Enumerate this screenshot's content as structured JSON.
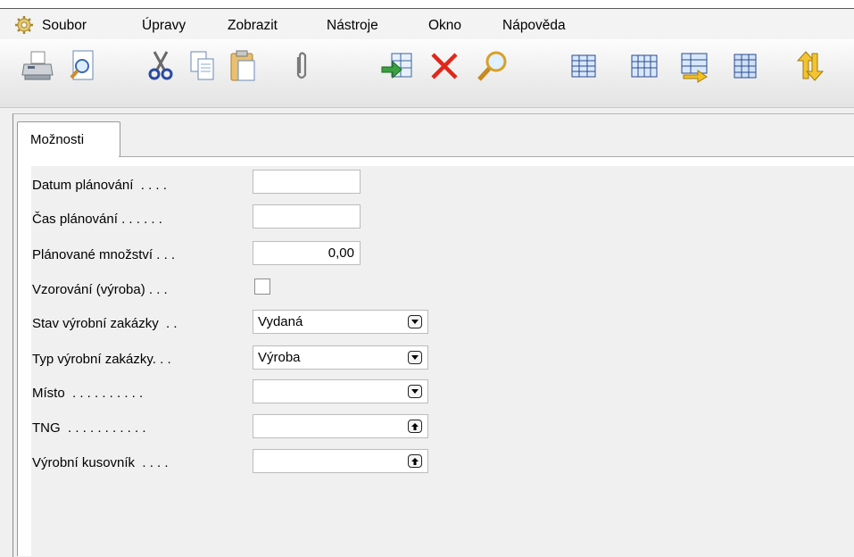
{
  "menu": {
    "items": [
      "Soubor",
      "Úpravy",
      "Zobrazit",
      "Nástroje",
      "Okno",
      "Nápověda"
    ]
  },
  "toolbar": {
    "icons": [
      "printer-icon",
      "print-preview-icon",
      "cut-icon",
      "copy-icon",
      "paste-icon",
      "attachment-icon",
      "export-icon",
      "delete-icon",
      "find-icon",
      "list-view-icon",
      "card-view-icon",
      "transfer-icon",
      "grid-icon",
      "sort-icon"
    ]
  },
  "tabs": [
    {
      "label": "Možnosti"
    }
  ],
  "form": {
    "fields": [
      {
        "label": "Datum plánování  . . . .",
        "value": ""
      },
      {
        "label": "Čas plánování . . . . . .",
        "value": ""
      },
      {
        "label": "Plánované množství . . .",
        "value": "0,00"
      },
      {
        "label": "Vzorování (výroba) . . .",
        "value": ""
      },
      {
        "label": "Stav výrobní zakázky  . .",
        "value": "Vydaná"
      },
      {
        "label": "Typ výrobní zakázky. . .",
        "value": "Výroba"
      },
      {
        "label": "Místo  . . . . . . . . . .",
        "value": ""
      },
      {
        "label": "TNG  . . . . . . . . . . .",
        "value": ""
      },
      {
        "label": "Výrobní kusovník  . . . .",
        "value": ""
      }
    ]
  }
}
